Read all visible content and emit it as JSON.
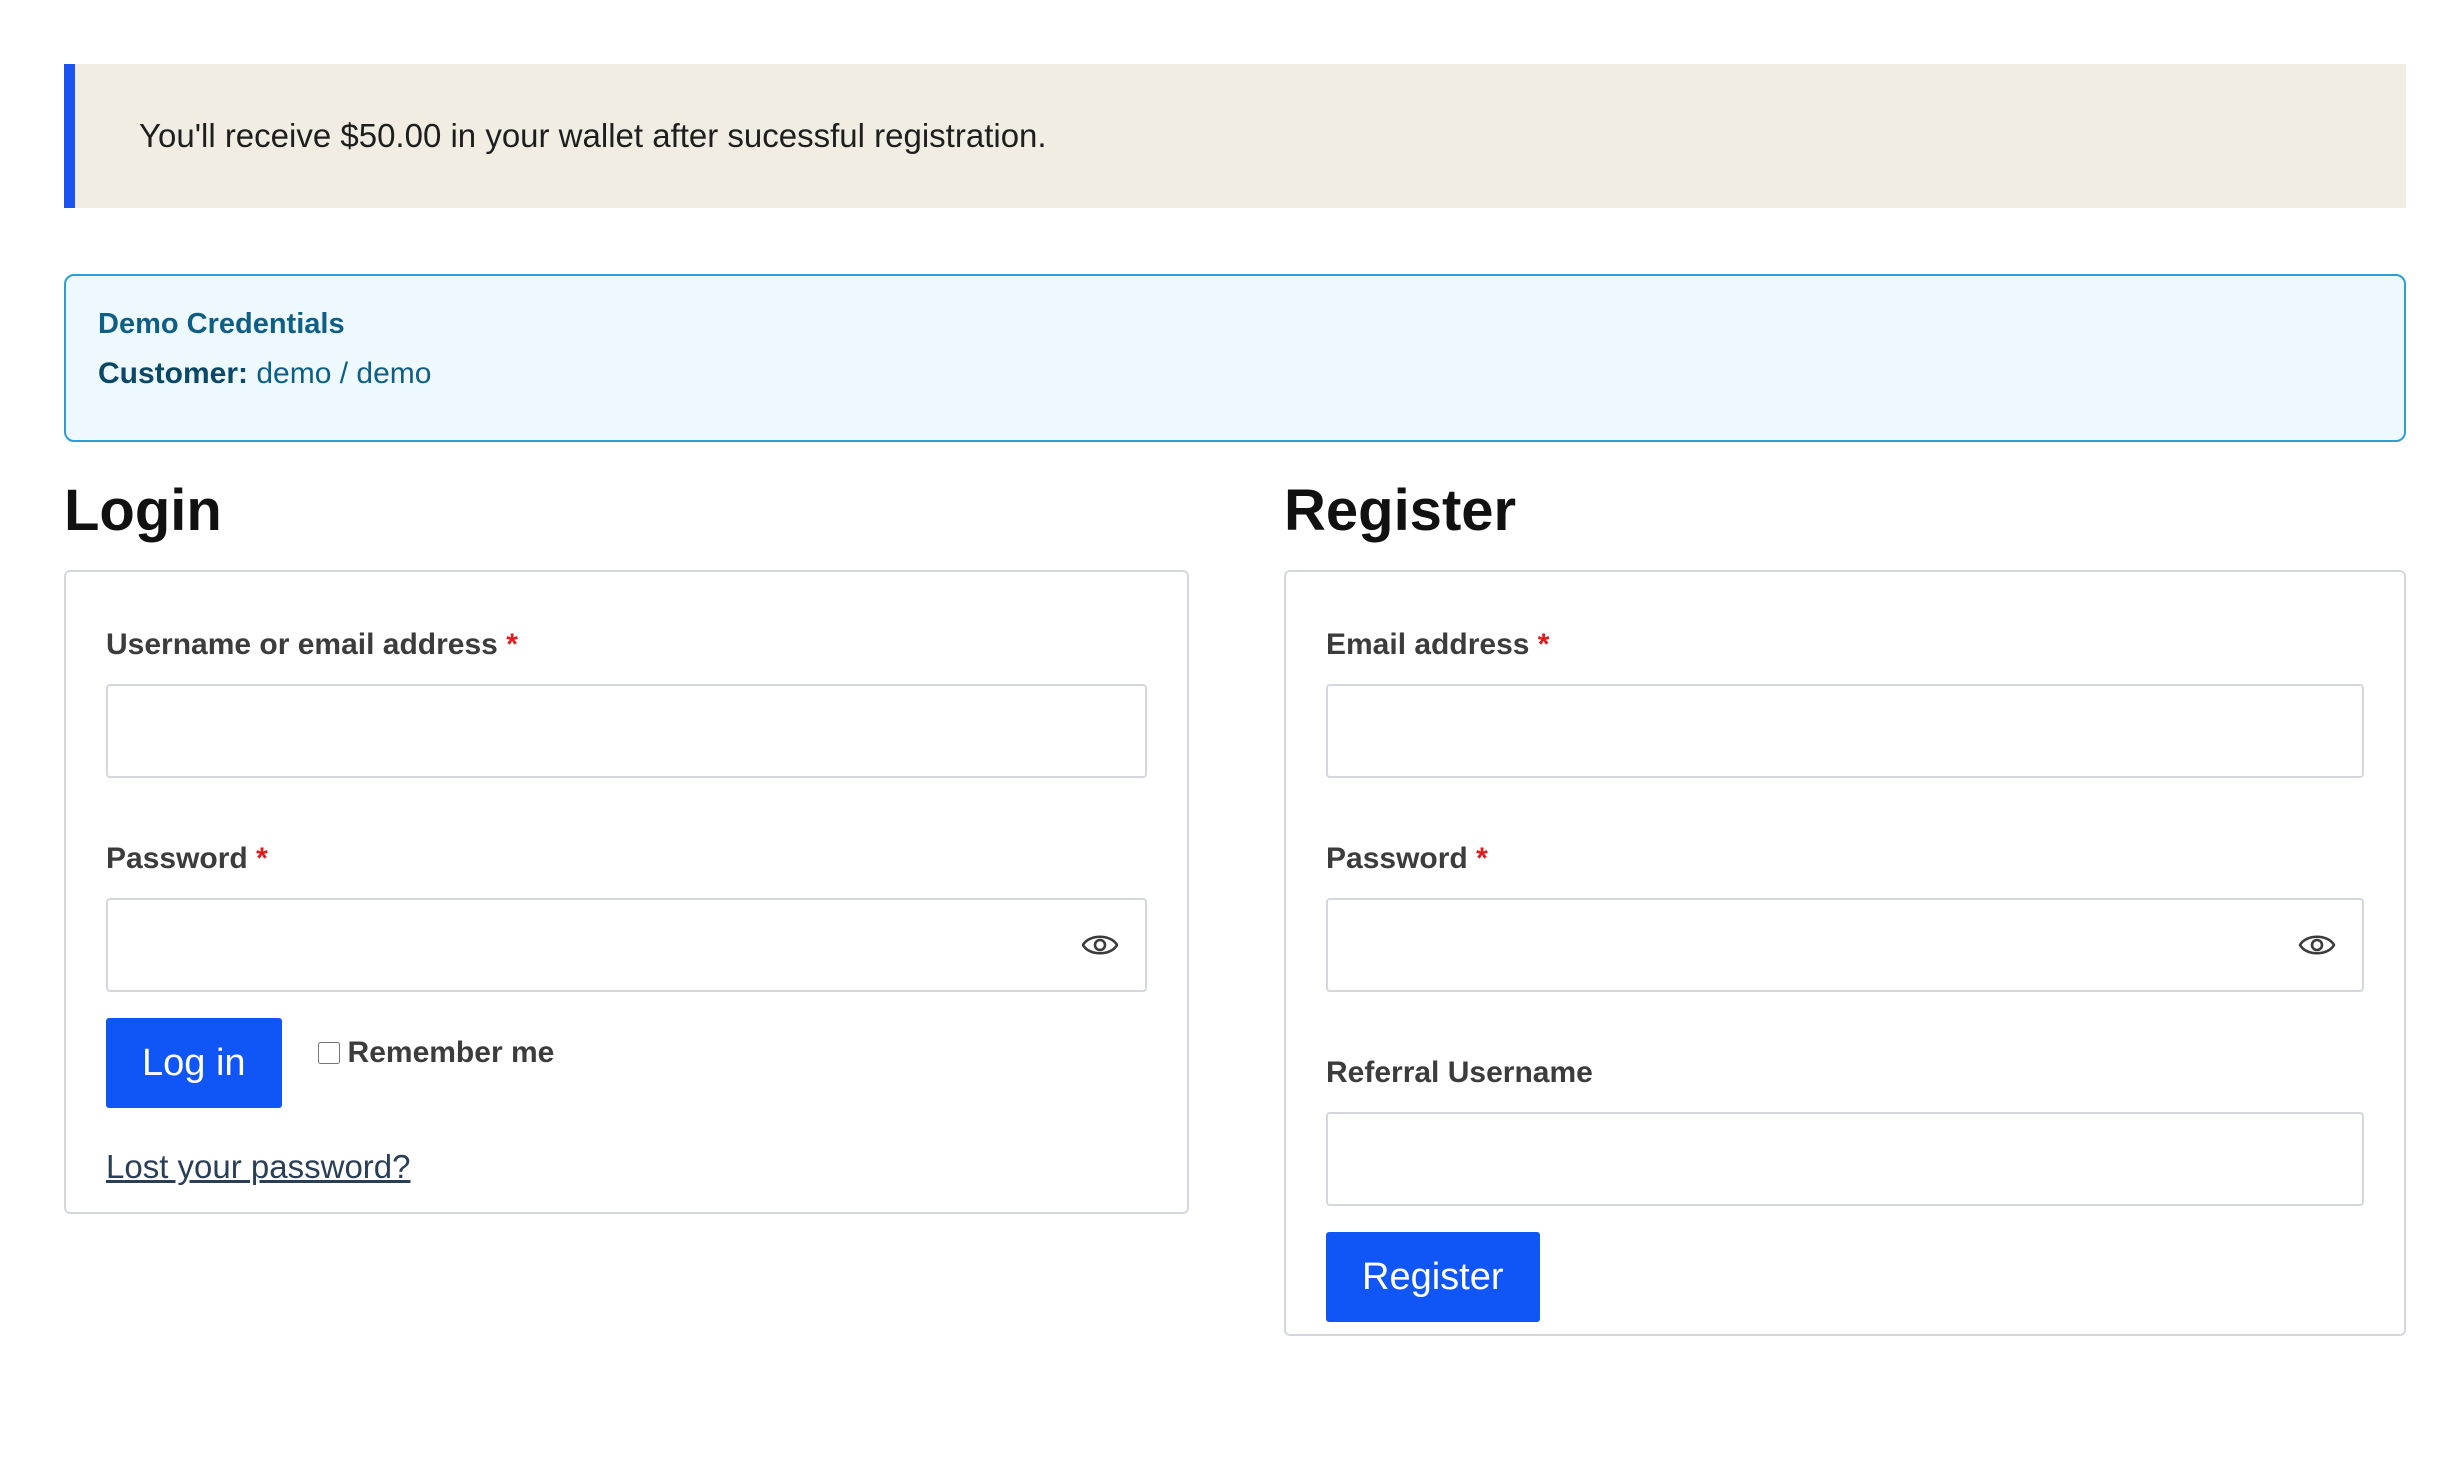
{
  "notice": {
    "text": "You'll receive $50.00 in your wallet after sucessful registration."
  },
  "demo": {
    "title": "Demo Credentials",
    "customer_label": "Customer:",
    "customer_value": "demo / demo"
  },
  "login": {
    "title": "Login",
    "username_label": "Username or email address",
    "password_label": "Password",
    "required_mark": "*",
    "submit_label": "Log in",
    "remember_label": "Remember me",
    "lost_password_label": "Lost your password?"
  },
  "register": {
    "title": "Register",
    "email_label": "Email address",
    "password_label": "Password",
    "required_mark": "*",
    "referral_label": "Referral Username",
    "submit_label": "Register"
  },
  "colors": {
    "accent": "#1056f7",
    "notice_bar": "#1a53f0",
    "notice_bg": "#f1ede2",
    "info_border": "#2b9fd6",
    "info_bg": "#eef8ff",
    "required": "#e01b1b"
  },
  "icons": {
    "password_toggle": "eye-icon"
  }
}
